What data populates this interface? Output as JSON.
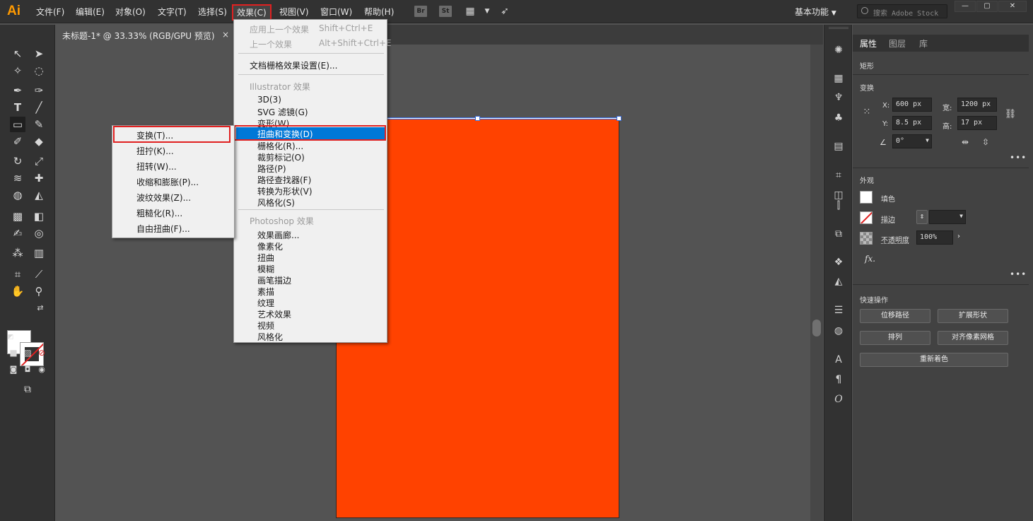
{
  "app": {
    "logo": "Ai"
  },
  "menubar": {
    "items": [
      "文件(F)",
      "编辑(E)",
      "对象(O)",
      "文字(T)",
      "选择(S)",
      "效果(C)",
      "视图(V)",
      "窗口(W)",
      "帮助(H)"
    ],
    "bridge_label": "Br",
    "stock_label": "St",
    "workspace": "基本功能",
    "search_placeholder": "搜索 Adobe Stock"
  },
  "document": {
    "tab_title": "未标题-1* @ 33.33% (RGB/GPU 预览)",
    "close_glyph": "×"
  },
  "effects_menu": {
    "apply_last": "应用上一个效果",
    "apply_last_shortcut": "Shift+Ctrl+E",
    "last_effect": "上一个效果",
    "last_effect_shortcut": "Alt+Shift+Ctrl+E",
    "raster_settings": "文档栅格效果设置(E)...",
    "illustrator_header": "Illustrator 效果",
    "illustrator_items": [
      "3D(3)",
      "SVG 滤镜(G)",
      "变形(W)",
      "扭曲和变换(D)",
      "栅格化(R)...",
      "裁剪标记(O)",
      "路径(P)",
      "路径查找器(F)",
      "转换为形状(V)",
      "风格化(S)"
    ],
    "photoshop_header": "Photoshop 效果",
    "photoshop_items": [
      "效果画廊...",
      "像素化",
      "扭曲",
      "模糊",
      "画笔描边",
      "素描",
      "纹理",
      "艺术效果",
      "视频",
      "风格化"
    ]
  },
  "distort_submenu": {
    "items": [
      "变换(T)...",
      "扭拧(K)...",
      "扭转(W)...",
      "收缩和膨胀(P)...",
      "波纹效果(Z)...",
      "粗糙化(R)...",
      "自由扭曲(F)..."
    ]
  },
  "properties_panel": {
    "tabs": [
      "属性",
      "图层",
      "库"
    ],
    "object_type": "矩形",
    "transform_title": "变换",
    "x_label": "X:",
    "x_value": "600 px",
    "y_label": "Y:",
    "y_value": "8.5 px",
    "w_label": "宽:",
    "w_value": "1200 px",
    "h_label": "高:",
    "h_value": "17 px",
    "angle_value": "0°",
    "appearance_title": "外观",
    "fill_label": "填色",
    "stroke_label": "描边",
    "opacity_label": "不透明度",
    "opacity_value": "100%",
    "fx_label": "fx.",
    "quick_actions_title": "快速操作",
    "quick_actions": [
      "位移路径",
      "扩展形状",
      "排列",
      "对齐像素网格",
      "重新着色"
    ]
  },
  "colors": {
    "artboard": "#ff4200",
    "highlight": "#0078d7",
    "annotation_red": "#e02020"
  }
}
